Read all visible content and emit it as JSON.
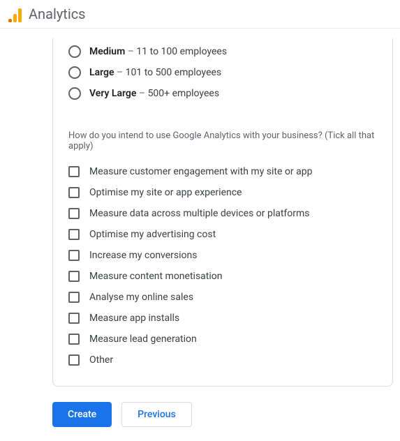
{
  "header": {
    "title": "Analytics"
  },
  "radios": [
    {
      "name": "Medium",
      "desc": "11 to 100 employees"
    },
    {
      "name": "Large",
      "desc": "101 to 500 employees"
    },
    {
      "name": "Very Large",
      "desc": "500+ employees"
    }
  ],
  "question": "How do you intend to use Google Analytics with your business? (Tick all that apply)",
  "checkboxes": [
    "Measure customer engagement with my site or app",
    "Optimise my site or app experience",
    "Measure data across multiple devices or platforms",
    "Optimise my advertising cost",
    "Increase my conversions",
    "Measure content monetisation",
    "Analyse my online sales",
    "Measure app installs",
    "Measure lead generation",
    "Other"
  ],
  "buttons": {
    "create": "Create",
    "previous": "Previous"
  }
}
